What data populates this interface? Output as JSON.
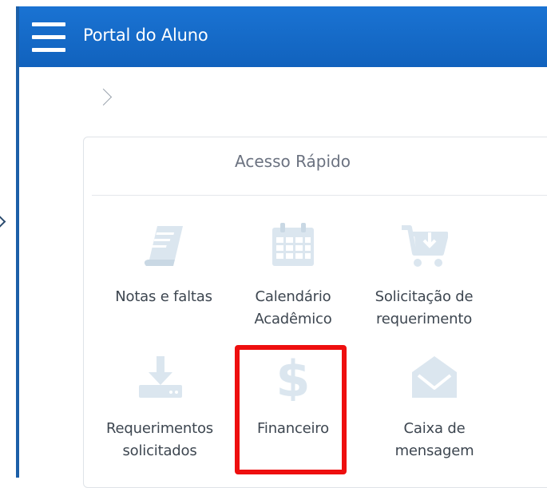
{
  "header": {
    "title": "Portal do Aluno"
  },
  "panel": {
    "title": "Acesso Rápido"
  },
  "tiles": [
    {
      "label_line1": "Notas e faltas",
      "label_line2": "",
      "icon": "book-icon"
    },
    {
      "label_line1": "Calendário",
      "label_line2": "Acadêmico",
      "icon": "calendar-icon"
    },
    {
      "label_line1": "Solicitação de",
      "label_line2": "requerimento",
      "icon": "cart-download-icon"
    },
    {
      "label_line1": "Requerimentos",
      "label_line2": "solicitados",
      "icon": "download-tray-icon"
    },
    {
      "label_line1": "Financeiro",
      "label_line2": "",
      "icon": "dollar-icon"
    },
    {
      "label_line1": "Caixa de",
      "label_line2": "mensagem",
      "icon": "envelope-icon"
    }
  ],
  "colors": {
    "header_blue": "#1162bd",
    "icon_tint": "#dbe6ef",
    "highlight_red": "#ee0f0f"
  }
}
